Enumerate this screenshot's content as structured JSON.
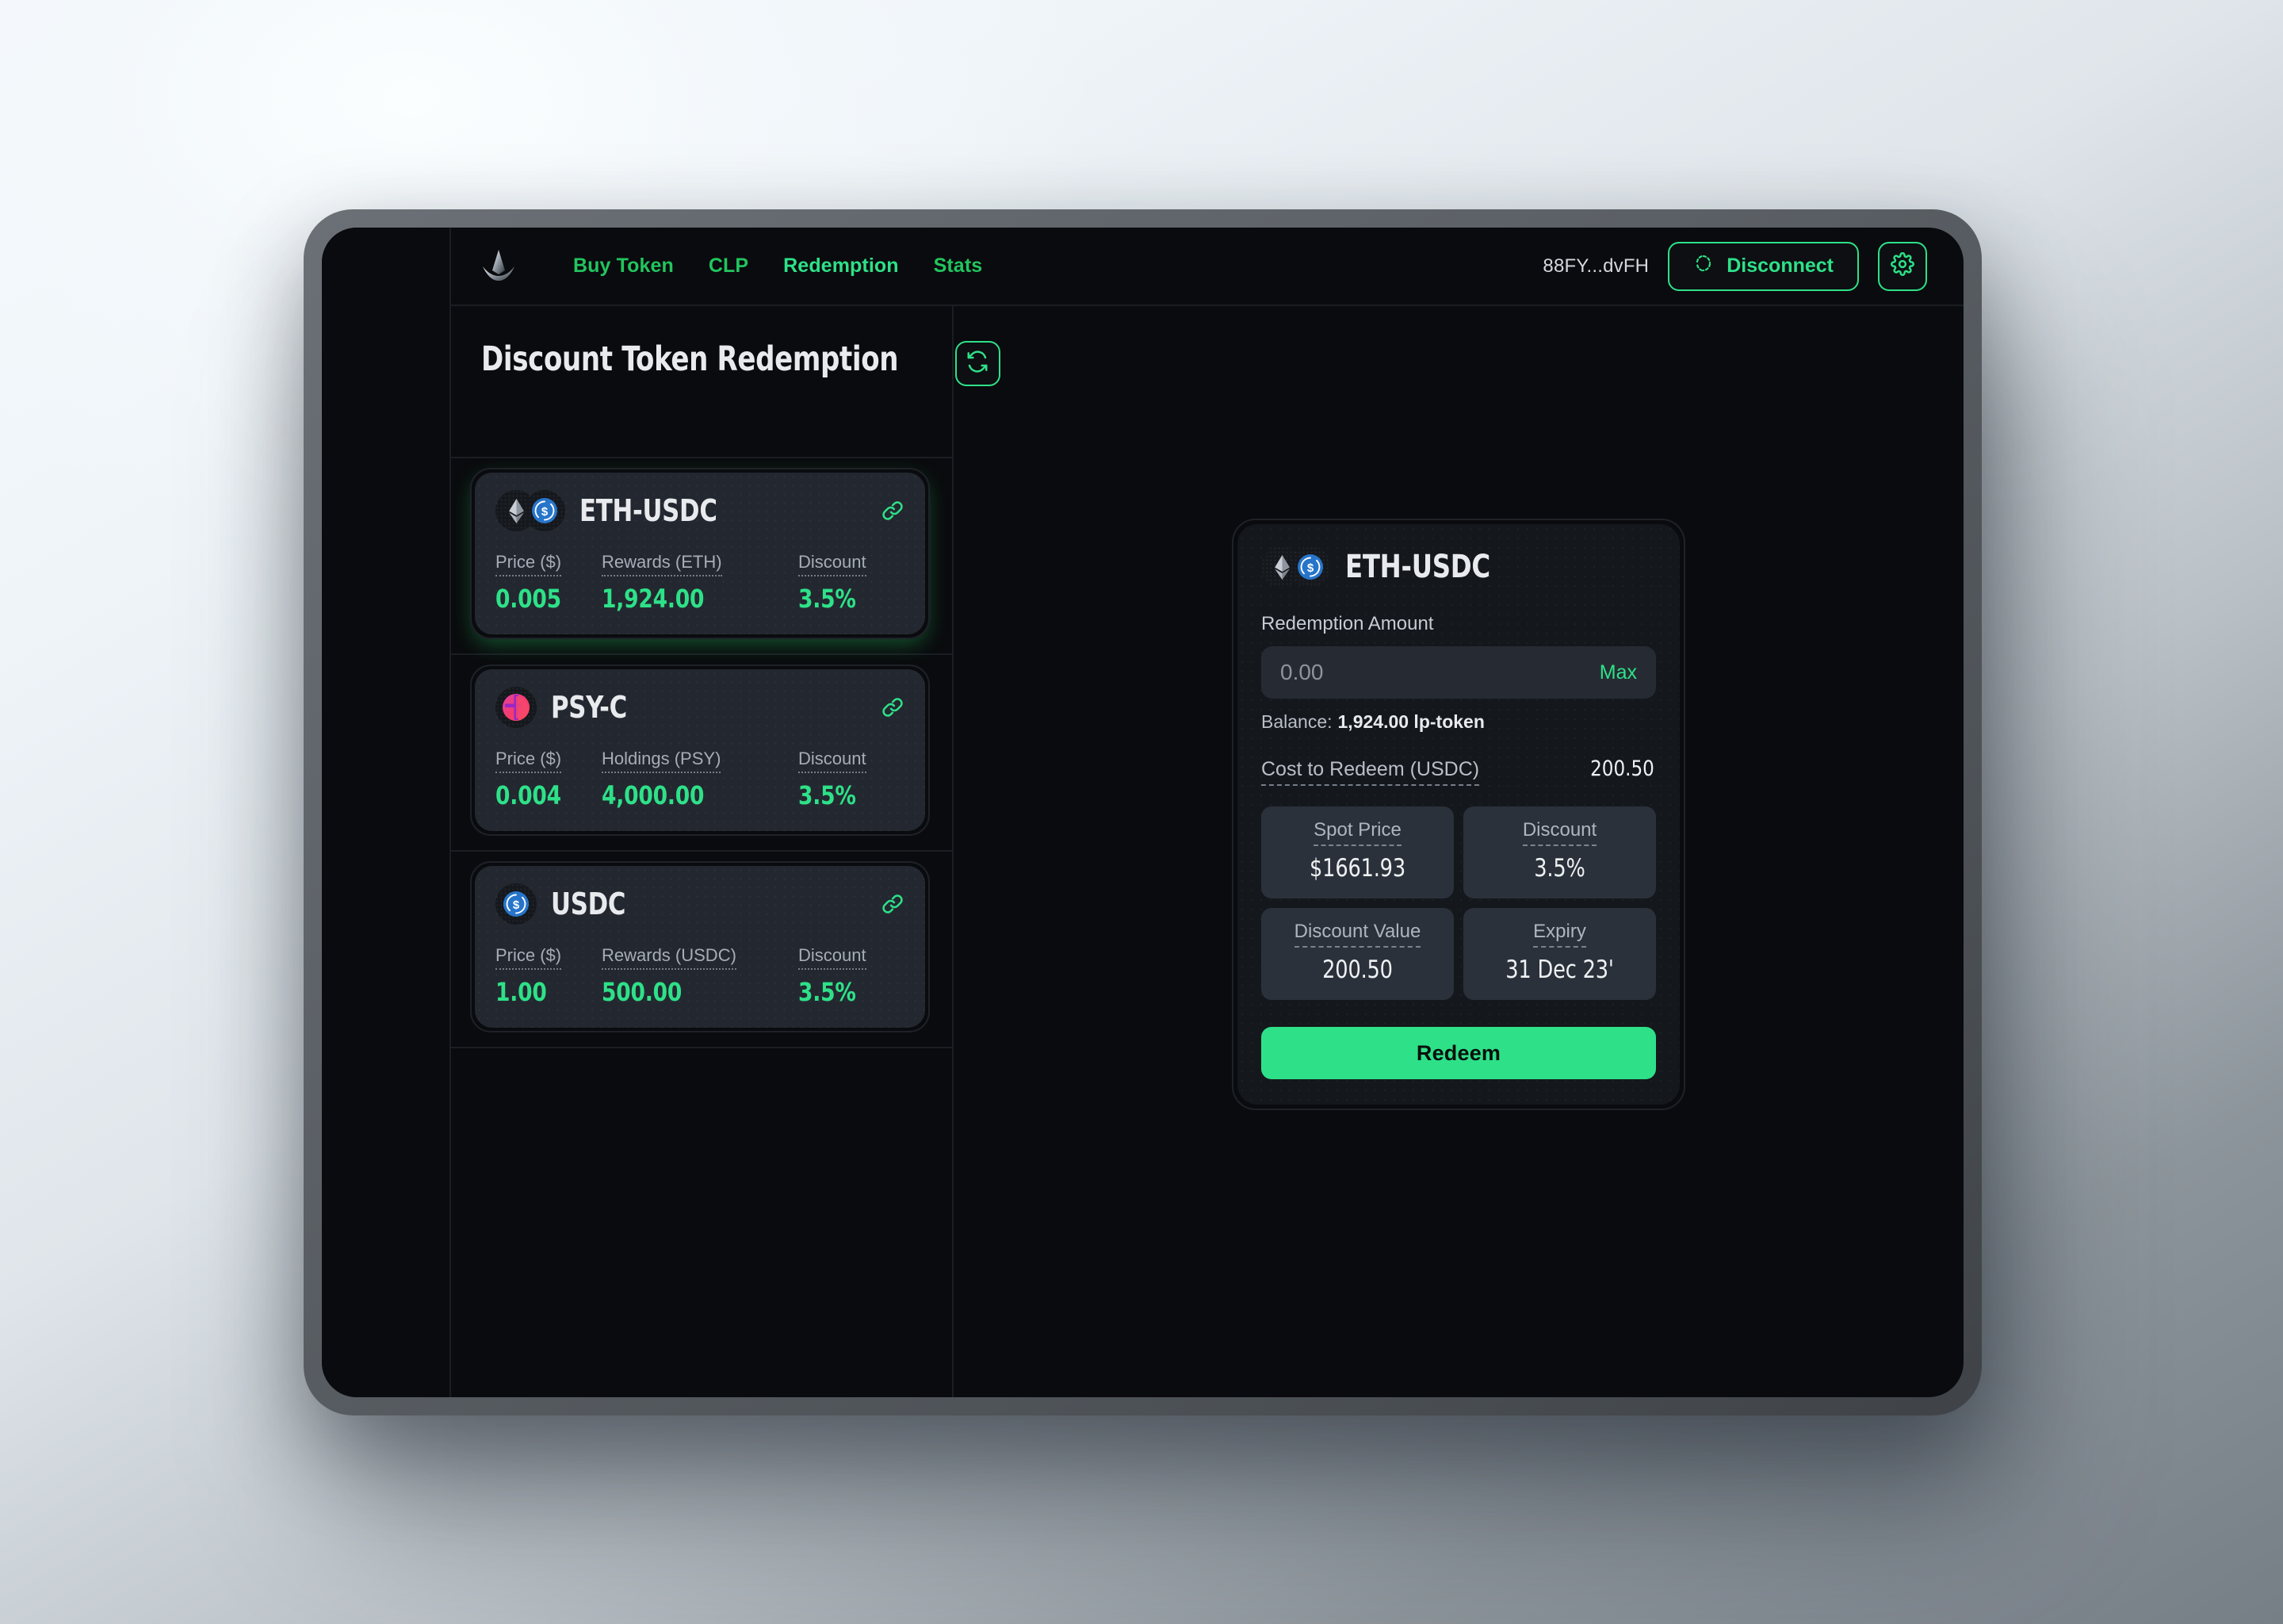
{
  "brand": {
    "logo_icon": "trident-logo-icon"
  },
  "nav": {
    "links": [
      {
        "label": "Buy Token",
        "active": false
      },
      {
        "label": "CLP",
        "active": false
      },
      {
        "label": "Redemption",
        "active": true
      },
      {
        "label": "Stats",
        "active": false
      }
    ],
    "wallet_address": "88FY...dvFH",
    "disconnect_label": "Disconnect",
    "disconnect_icon": "broken-link-icon",
    "settings_icon": "gear-icon"
  },
  "page": {
    "title": "Discount Token Redemption",
    "refresh_icon": "refresh-icon"
  },
  "tokens": [
    {
      "name": "ETH-USDC",
      "icons": [
        "ethereum-coin-icon",
        "usdc-coin-icon"
      ],
      "selected": true,
      "link_icon": "external-link-icon",
      "stats": [
        {
          "label": "Price ($)",
          "value": "0.005"
        },
        {
          "label": "Rewards (ETH)",
          "value": "1,924.00"
        },
        {
          "label": "Discount",
          "value": "3.5%"
        }
      ]
    },
    {
      "name": "PSY-C",
      "icons": [
        "psy-coin-icon"
      ],
      "selected": false,
      "link_icon": "external-link-icon",
      "stats": [
        {
          "label": "Price ($)",
          "value": "0.004"
        },
        {
          "label": "Holdings (PSY)",
          "value": "4,000.00"
        },
        {
          "label": "Discount",
          "value": "3.5%"
        }
      ]
    },
    {
      "name": "USDC",
      "icons": [
        "usdc-coin-icon"
      ],
      "selected": false,
      "link_icon": "external-link-icon",
      "stats": [
        {
          "label": "Price ($)",
          "value": "1.00"
        },
        {
          "label": "Rewards (USDC)",
          "value": "500.00"
        },
        {
          "label": "Discount",
          "value": "3.5%"
        }
      ]
    }
  ],
  "redemption": {
    "token_name": "ETH-USDC",
    "icons": [
      "ethereum-coin-icon",
      "usdc-coin-icon"
    ],
    "amount_label": "Redemption Amount",
    "amount_value": "",
    "amount_placeholder": "0.00",
    "max_label": "Max",
    "balance_label": "Balance:",
    "balance_value": "1,924.00 lp-token",
    "cost_label": "Cost to Redeem (USDC)",
    "cost_value": "200.50",
    "boxes": [
      {
        "label": "Spot Price",
        "value": "$1661.93"
      },
      {
        "label": "Discount",
        "value": "3.5%"
      },
      {
        "label": "Discount Value",
        "value": "200.50"
      },
      {
        "label": "Expiry",
        "value": "31 Dec 23'"
      }
    ],
    "redeem_label": "Redeem"
  },
  "colors": {
    "accent_green": "#2ee188",
    "nav_green": "#22c55e",
    "screen_bg": "#0a0b0e",
    "card_bg": "#232830",
    "panel_bg": "#14171c"
  }
}
